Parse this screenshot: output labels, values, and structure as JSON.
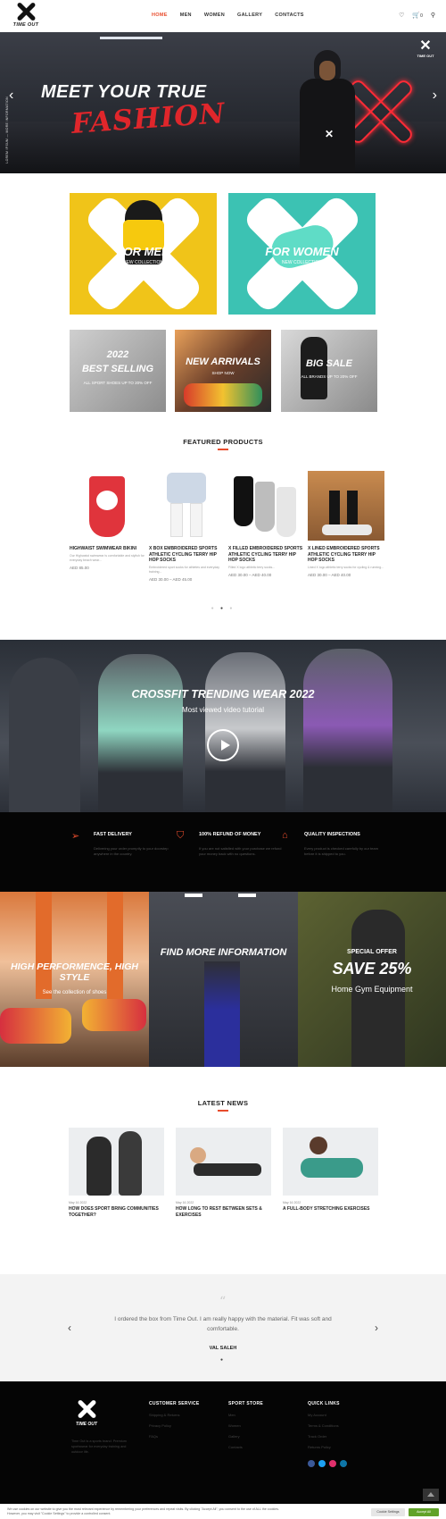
{
  "header": {
    "logo_text": "TIME OUT",
    "nav": [
      "HOME",
      "MEN",
      "WOMEN",
      "GALLERY",
      "CONTACTS"
    ],
    "cart_count": "0"
  },
  "hero": {
    "title_line1": "MEET YOUR TRUE",
    "title_line2": "FASHION",
    "brand_text": "TIME OUT",
    "vertical_text": "LOREM IPSUM — MORE INFORMATION"
  },
  "categories": {
    "men": {
      "title": "FOR MEN",
      "subtitle": "NEW COLLECTION"
    },
    "women": {
      "title": "FOR WOMEN",
      "subtitle": "NEW COLLECTION"
    },
    "best": {
      "year": "2022",
      "title": "BEST SELLING",
      "subtitle": "ALL SPORT SHOES UP TO 20% OFF"
    },
    "arrivals": {
      "title": "NEW ARRIVALS",
      "subtitle": "SHOP NOW"
    },
    "sale": {
      "title": "BIG SALE",
      "subtitle": "ALL BRANDS UP TO 20% OFF"
    }
  },
  "featured": {
    "title": "FEATURED PRODUCTS",
    "products": [
      {
        "name": "HIGHWAIST SWIMWEAR BIKINI",
        "desc": "Our Highwaist swimwear is comfortable and stylish for everyday beach wear...",
        "price": "AED 85.00"
      },
      {
        "name": "X BOX EMBROIDERED SPORTS ATHLETIC CYCLING TERRY HIP HOP SOCKS",
        "desc": "Embroidered sport socks for athletes and everyday training...",
        "price": "AED 30.00 – AED 45.00"
      },
      {
        "name": "X FILLED EMBROIDERED SPORTS ATHLETIC CYCLING TERRY HIP HOP SOCKS",
        "desc": "Filled X logo athletic terry socks...",
        "price": "AED 30.00 – AED 40.00"
      },
      {
        "name": "X LINED EMBROIDERED SPORTS ATHLETIC CYCLING TERRY HIP HOP SOCKS",
        "desc": "Lined X logo athletic terry socks for cycling & running...",
        "price": "AED 30.00 – AED 40.00"
      }
    ]
  },
  "video": {
    "title": "CROSSFIT TRENDING WEAR 2022",
    "subtitle": "Most viewed video tutorial"
  },
  "features": [
    {
      "icon": "plane-icon",
      "title": "FAST DELIVERY",
      "text": "Delivering your order promptly to your doorstep anywhere in the country."
    },
    {
      "icon": "shield-icon",
      "title": "100% REFUND OF MONEY",
      "text": "If you are not satisfied with your purchase we refund your money back with no questions."
    },
    {
      "icon": "house-icon",
      "title": "QUALITY INSPECTIONS",
      "text": "Every product is checked carefully by our team before it is shipped to you."
    }
  ],
  "promos": {
    "left": {
      "title": "HIGH PERFORMENCE, HIGH STYLE",
      "subtitle": "See the collection of shoes"
    },
    "middle": {
      "title": "FIND MORE INFORMATION"
    },
    "right": {
      "label": "SPECIAL OFFER",
      "title": "SAVE 25%",
      "subtitle": "Home Gym Equipment"
    }
  },
  "news": {
    "title": "LATEST NEWS",
    "items": [
      {
        "date": "May 16 2022",
        "title": "HOW DOES SPORT BRING COMMUNITIES TOGETHER?"
      },
      {
        "date": "May 16 2022",
        "title": "HOW LONG TO REST BETWEEN SETS & EXERCISES"
      },
      {
        "date": "May 16 2022",
        "title": "A FULL-BODY STRETCHING EXERCISES"
      }
    ]
  },
  "testimonial": {
    "quote_mark": "“",
    "text": "I ordered the box from Time Out. I am really happy with the material. Fit was soft and comfortable.",
    "author": "VAL SALEH"
  },
  "footer": {
    "logo_text": "TIME OUT",
    "about": "Time Out is a sports brand. Premium sportswear for everyday training and outdoor life.",
    "columns": [
      {
        "title": "CUSTOMER SERVICE",
        "items": [
          "Shipping & Returns",
          "Privacy Policy",
          "FAQs"
        ]
      },
      {
        "title": "SPORT STORE",
        "items": [
          "Men",
          "Women",
          "Gallery",
          "Contacts"
        ]
      },
      {
        "title": "QUICK LINKS",
        "items": [
          "My Account",
          "Terms & Conditions",
          "Track Order",
          "Returns Policy"
        ]
      }
    ],
    "social_colors": [
      "#3b5998",
      "#1da1f2",
      "#e1306c",
      "#0e76a8"
    ]
  },
  "cookie": {
    "text": "We use cookies on our website to give you the most relevant experience by remembering your preferences and repeat visits. By clicking \"Accept All\", you consent to the use of ALL the cookies. However, you may visit \"Cookie Settings\" to provide a controlled consent.",
    "settings_label": "Cookie Settings",
    "accept_label": "Accept All"
  },
  "colors": {
    "accent": "#e84c2c",
    "hero_red": "#e0262b",
    "men_tile": "#f0c419",
    "women_tile": "#3cc2b3",
    "accept_green": "#61a229"
  }
}
